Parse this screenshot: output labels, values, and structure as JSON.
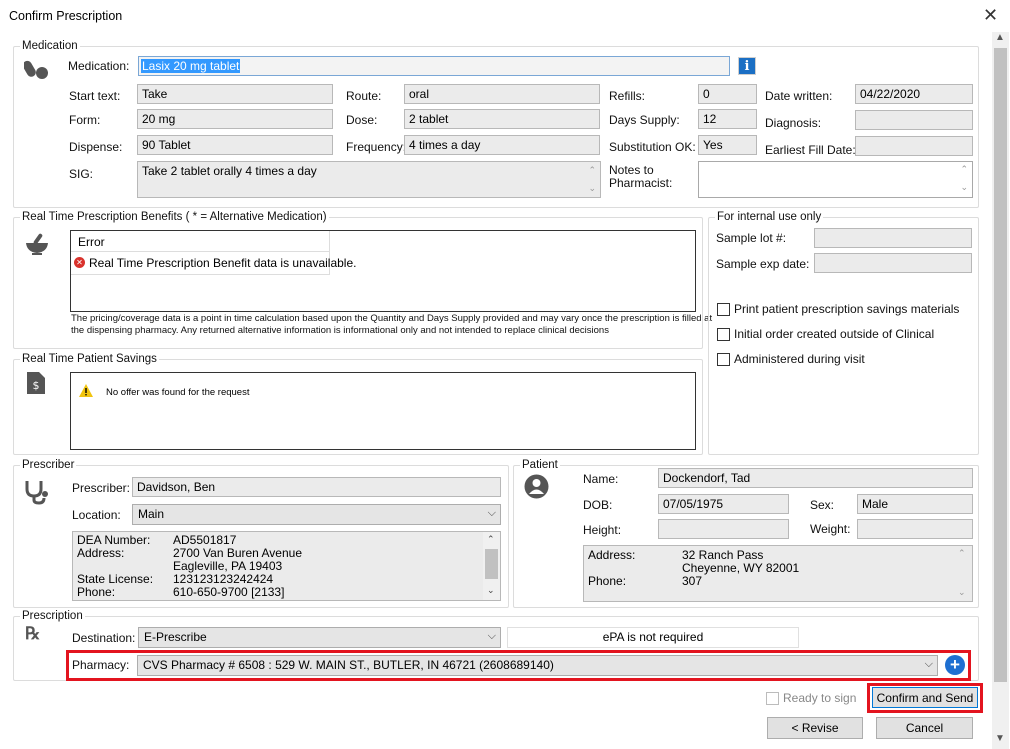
{
  "window": {
    "title": "Confirm Prescription"
  },
  "medication": {
    "group_title": "Medication",
    "medication_label": "Medication:",
    "medication_value": "Lasix 20 mg tablet",
    "start_text_label": "Start text:",
    "start_text_value": "Take",
    "route_label": "Route:",
    "route_value": "oral",
    "refills_label": "Refills:",
    "refills_value": "0",
    "date_written_label": "Date written:",
    "date_written_value": "04/22/2020",
    "form_label": "Form:",
    "form_value": "20 mg",
    "dose_label": "Dose:",
    "dose_value": "2 tablet",
    "days_supply_label": "Days Supply:",
    "days_supply_value": "12",
    "diagnosis_label": "Diagnosis:",
    "diagnosis_value": "",
    "dispense_label": "Dispense:",
    "dispense_value": "90 Tablet",
    "frequency_label": "Frequency:",
    "frequency_value": "4 times a day",
    "substitution_label": "Substitution OK:",
    "substitution_value": "Yes",
    "earliest_fill_label": "Earliest Fill Date:",
    "earliest_fill_value": "",
    "sig_label": "SIG:",
    "sig_value": "Take 2 tablet orally 4 times a day",
    "notes_label_1": "Notes to",
    "notes_label_2": "Pharmacist:",
    "notes_value": ""
  },
  "rtpb": {
    "group_title": "Real Time Prescription Benefits ( * = Alternative Medication)",
    "error_header": "Error",
    "error_message": "Real Time Prescription Benefit data is unavailable.",
    "disclaimer_1": "The pricing/coverage data is a point in time calculation based upon the Quantity and Days Supply provided and may vary once the prescription is filled at",
    "disclaimer_2": "the dispensing pharmacy. Any returned alternative information is informational only and not intended to replace clinical decisions"
  },
  "internal": {
    "group_title": "For internal use only",
    "sample_lot_label": "Sample lot #:",
    "sample_exp_label": "Sample exp date:",
    "print_savings_label": "Print patient prescription savings materials",
    "initial_order_label": "Initial order created outside of Clinical",
    "administered_label": "Administered during visit"
  },
  "savings": {
    "group_title": "Real Time Patient Savings",
    "message": "No offer was found for the request"
  },
  "prescriber": {
    "group_title": "Prescriber",
    "prescriber_label": "Prescriber:",
    "prescriber_value": "Davidson, Ben",
    "location_label": "Location:",
    "location_value": "Main",
    "details": {
      "dea_label": "DEA Number:",
      "dea_value": "AD5501817",
      "address_label": "Address:",
      "address_line1": "2700 Van Buren Avenue",
      "address_line2": "Eagleville, PA 19403",
      "license_label": "State License:",
      "license_value": "123123123242424",
      "phone_label": "Phone:",
      "phone_value": "610-650-9700 [2133]"
    }
  },
  "patient": {
    "group_title": "Patient",
    "name_label": "Name:",
    "name_value": "Dockendorf, Tad",
    "dob_label": "DOB:",
    "dob_value": "07/05/1975",
    "sex_label": "Sex:",
    "sex_value": "Male",
    "height_label": "Height:",
    "height_value": "",
    "weight_label": "Weight:",
    "weight_value": "",
    "address_label": "Address:",
    "address_line1": "32 Ranch Pass",
    "address_line2": "Cheyenne, WY 82001",
    "phone_label": "Phone:",
    "phone_value": "307"
  },
  "prescription": {
    "group_title": "Prescription",
    "destination_label": "Destination:",
    "destination_value": "E-Prescribe",
    "epa_status": "ePA is not required",
    "pharmacy_label": "Pharmacy:",
    "pharmacy_value": "CVS Pharmacy # 6508 :  529 W. MAIN ST., BUTLER, IN 46721 (2608689140)"
  },
  "buttons": {
    "ready_to_sign": "Ready to sign",
    "confirm_send": "Confirm and Send",
    "revise": "< Revise",
    "cancel": "Cancel"
  },
  "colors": {
    "highlight_red": "#e3141f",
    "selection_blue": "#3399ff",
    "info_blue": "#1b6fc4"
  }
}
